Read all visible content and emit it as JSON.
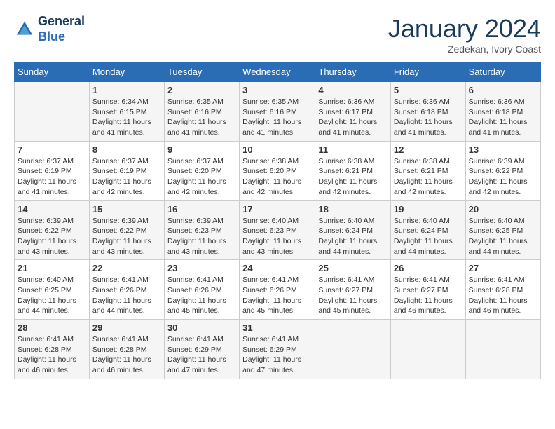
{
  "logo": {
    "line1": "General",
    "line2": "Blue"
  },
  "title": "January 2024",
  "location": "Zedekan, Ivory Coast",
  "days_header": [
    "Sunday",
    "Monday",
    "Tuesday",
    "Wednesday",
    "Thursday",
    "Friday",
    "Saturday"
  ],
  "weeks": [
    [
      {
        "day": "",
        "info": ""
      },
      {
        "day": "1",
        "info": "Sunrise: 6:34 AM\nSunset: 6:15 PM\nDaylight: 11 hours and 41 minutes."
      },
      {
        "day": "2",
        "info": "Sunrise: 6:35 AM\nSunset: 6:16 PM\nDaylight: 11 hours and 41 minutes."
      },
      {
        "day": "3",
        "info": "Sunrise: 6:35 AM\nSunset: 6:16 PM\nDaylight: 11 hours and 41 minutes."
      },
      {
        "day": "4",
        "info": "Sunrise: 6:36 AM\nSunset: 6:17 PM\nDaylight: 11 hours and 41 minutes."
      },
      {
        "day": "5",
        "info": "Sunrise: 6:36 AM\nSunset: 6:18 PM\nDaylight: 11 hours and 41 minutes."
      },
      {
        "day": "6",
        "info": "Sunrise: 6:36 AM\nSunset: 6:18 PM\nDaylight: 11 hours and 41 minutes."
      }
    ],
    [
      {
        "day": "7",
        "info": "Sunrise: 6:37 AM\nSunset: 6:19 PM\nDaylight: 11 hours and 41 minutes."
      },
      {
        "day": "8",
        "info": "Sunrise: 6:37 AM\nSunset: 6:19 PM\nDaylight: 11 hours and 42 minutes."
      },
      {
        "day": "9",
        "info": "Sunrise: 6:37 AM\nSunset: 6:20 PM\nDaylight: 11 hours and 42 minutes."
      },
      {
        "day": "10",
        "info": "Sunrise: 6:38 AM\nSunset: 6:20 PM\nDaylight: 11 hours and 42 minutes."
      },
      {
        "day": "11",
        "info": "Sunrise: 6:38 AM\nSunset: 6:21 PM\nDaylight: 11 hours and 42 minutes."
      },
      {
        "day": "12",
        "info": "Sunrise: 6:38 AM\nSunset: 6:21 PM\nDaylight: 11 hours and 42 minutes."
      },
      {
        "day": "13",
        "info": "Sunrise: 6:39 AM\nSunset: 6:22 PM\nDaylight: 11 hours and 42 minutes."
      }
    ],
    [
      {
        "day": "14",
        "info": "Sunrise: 6:39 AM\nSunset: 6:22 PM\nDaylight: 11 hours and 43 minutes."
      },
      {
        "day": "15",
        "info": "Sunrise: 6:39 AM\nSunset: 6:22 PM\nDaylight: 11 hours and 43 minutes."
      },
      {
        "day": "16",
        "info": "Sunrise: 6:39 AM\nSunset: 6:23 PM\nDaylight: 11 hours and 43 minutes."
      },
      {
        "day": "17",
        "info": "Sunrise: 6:40 AM\nSunset: 6:23 PM\nDaylight: 11 hours and 43 minutes."
      },
      {
        "day": "18",
        "info": "Sunrise: 6:40 AM\nSunset: 6:24 PM\nDaylight: 11 hours and 44 minutes."
      },
      {
        "day": "19",
        "info": "Sunrise: 6:40 AM\nSunset: 6:24 PM\nDaylight: 11 hours and 44 minutes."
      },
      {
        "day": "20",
        "info": "Sunrise: 6:40 AM\nSunset: 6:25 PM\nDaylight: 11 hours and 44 minutes."
      }
    ],
    [
      {
        "day": "21",
        "info": "Sunrise: 6:40 AM\nSunset: 6:25 PM\nDaylight: 11 hours and 44 minutes."
      },
      {
        "day": "22",
        "info": "Sunrise: 6:41 AM\nSunset: 6:26 PM\nDaylight: 11 hours and 44 minutes."
      },
      {
        "day": "23",
        "info": "Sunrise: 6:41 AM\nSunset: 6:26 PM\nDaylight: 11 hours and 45 minutes."
      },
      {
        "day": "24",
        "info": "Sunrise: 6:41 AM\nSunset: 6:26 PM\nDaylight: 11 hours and 45 minutes."
      },
      {
        "day": "25",
        "info": "Sunrise: 6:41 AM\nSunset: 6:27 PM\nDaylight: 11 hours and 45 minutes."
      },
      {
        "day": "26",
        "info": "Sunrise: 6:41 AM\nSunset: 6:27 PM\nDaylight: 11 hours and 46 minutes."
      },
      {
        "day": "27",
        "info": "Sunrise: 6:41 AM\nSunset: 6:28 PM\nDaylight: 11 hours and 46 minutes."
      }
    ],
    [
      {
        "day": "28",
        "info": "Sunrise: 6:41 AM\nSunset: 6:28 PM\nDaylight: 11 hours and 46 minutes."
      },
      {
        "day": "29",
        "info": "Sunrise: 6:41 AM\nSunset: 6:28 PM\nDaylight: 11 hours and 46 minutes."
      },
      {
        "day": "30",
        "info": "Sunrise: 6:41 AM\nSunset: 6:29 PM\nDaylight: 11 hours and 47 minutes."
      },
      {
        "day": "31",
        "info": "Sunrise: 6:41 AM\nSunset: 6:29 PM\nDaylight: 11 hours and 47 minutes."
      },
      {
        "day": "",
        "info": ""
      },
      {
        "day": "",
        "info": ""
      },
      {
        "day": "",
        "info": ""
      }
    ]
  ]
}
